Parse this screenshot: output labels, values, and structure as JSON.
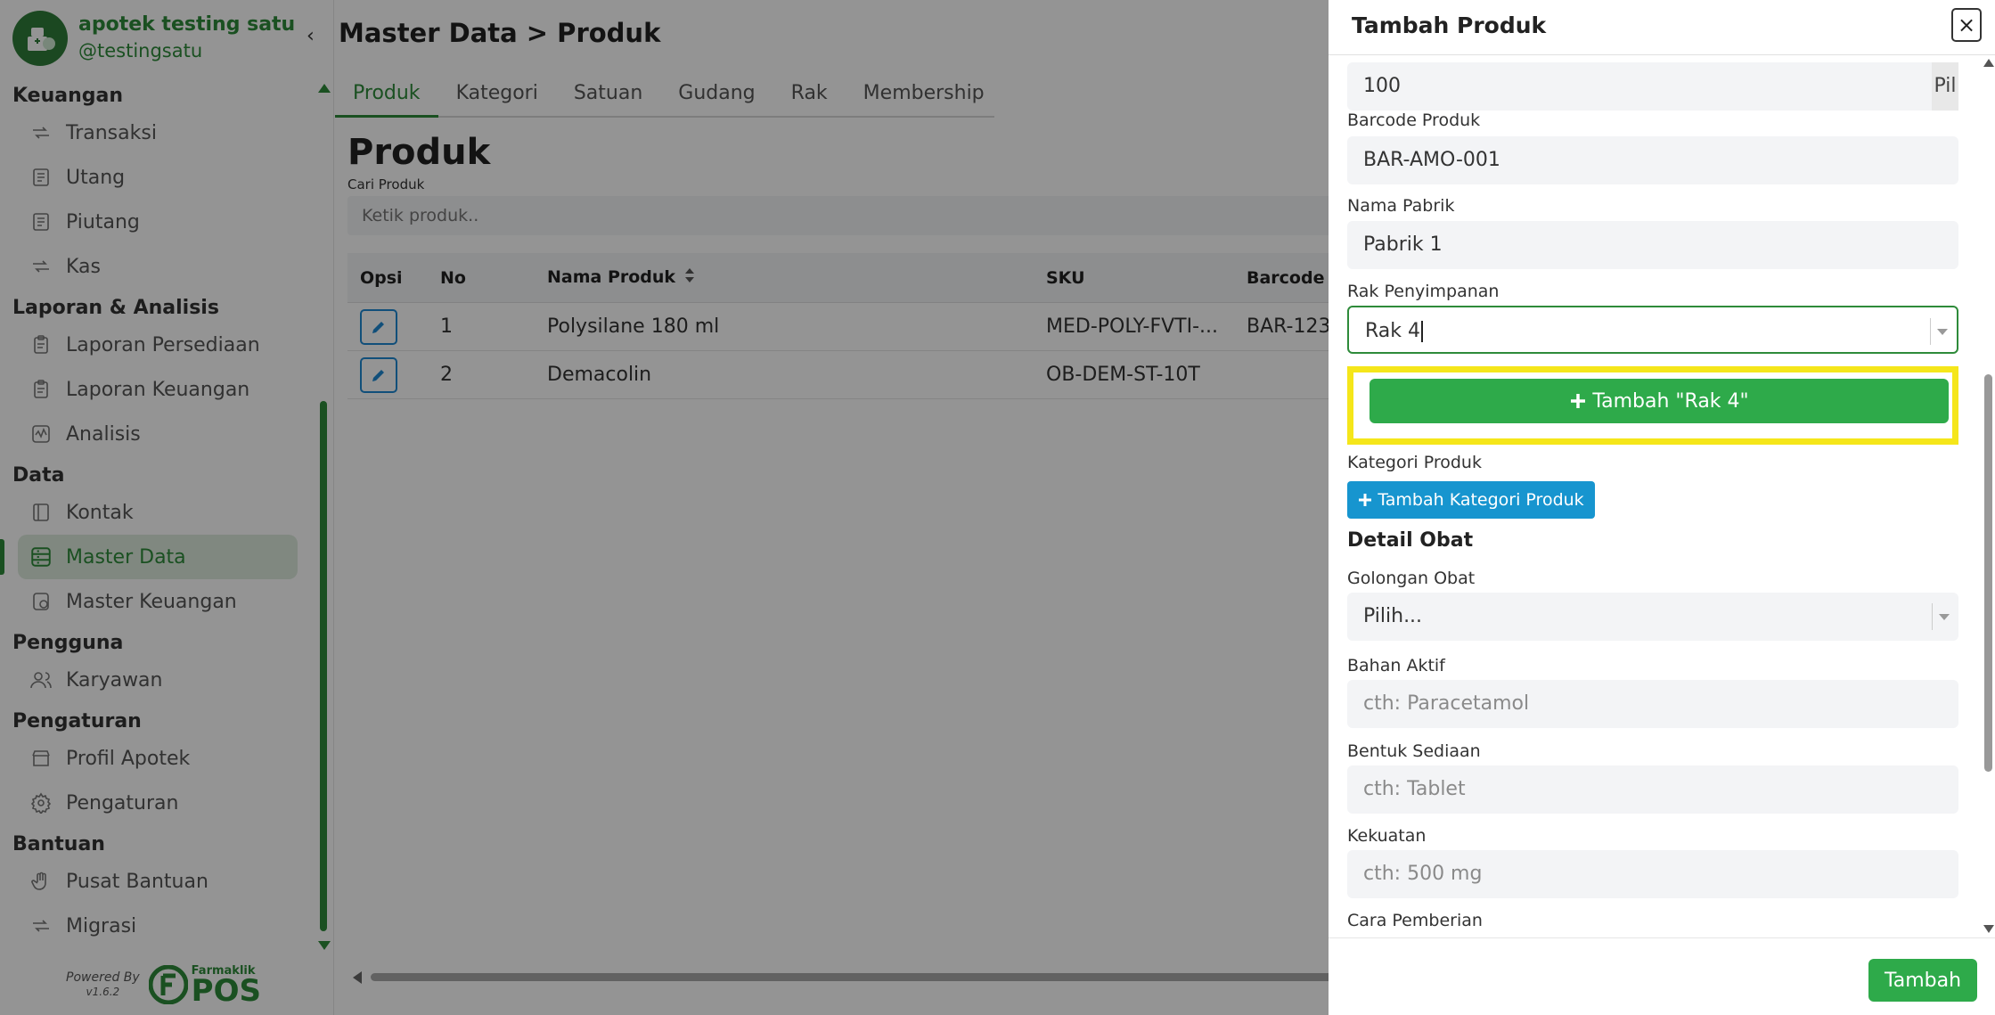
{
  "brand": {
    "name": "apotek testing satu",
    "handle": "@testingsatu"
  },
  "sidebar": {
    "sections": [
      {
        "title": "Keuangan",
        "items": [
          "Transaksi",
          "Utang",
          "Piutang",
          "Kas"
        ]
      },
      {
        "title": "Laporan & Analisis",
        "items": [
          "Laporan Persediaan",
          "Laporan Keuangan",
          "Analisis"
        ]
      },
      {
        "title": "Data",
        "items": [
          "Kontak",
          "Master Data",
          "Master Keuangan"
        ]
      },
      {
        "title": "Pengguna",
        "items": [
          "Karyawan"
        ]
      },
      {
        "title": "Pengaturan",
        "items": [
          "Profil Apotek",
          "Pengaturan"
        ]
      },
      {
        "title": "Bantuan",
        "items": [
          "Pusat Bantuan",
          "Migrasi"
        ]
      }
    ],
    "active_item": "Master Data",
    "powered_by": "Powered By",
    "version": "v1.6.2",
    "logo_small": "Farmaklik",
    "logo_big": "POS"
  },
  "main": {
    "page_title": "Master Data > Produk",
    "tabs": [
      "Produk",
      "Kategori",
      "Satuan",
      "Gudang",
      "Rak",
      "Membership"
    ],
    "section_title": "Produk",
    "search_label": "Cari Produk",
    "search_placeholder": "Ketik produk..",
    "table": {
      "headers": {
        "opsi": "Opsi",
        "no": "No",
        "nama": "Nama Produk",
        "sku": "SKU",
        "barcode": "Barcode"
      },
      "rows": [
        {
          "no": "1",
          "nama": "Polysilane 180 ml",
          "sku": "MED-POLY-FVTI-...",
          "barcode": "BAR-123"
        },
        {
          "no": "2",
          "nama": "Demacolin",
          "sku": "OB-DEM-ST-10T",
          "barcode": ""
        }
      ]
    }
  },
  "modal": {
    "title": "Tambah Produk",
    "close": "×",
    "qty_value": "100",
    "qty_unit": "Pil",
    "barcode_label": "Barcode Produk",
    "barcode_value": "BAR-AMO-001",
    "pabrik_label": "Nama Pabrik",
    "pabrik_value": "Pabrik 1",
    "rak_label": "Rak Penyimpanan",
    "rak_value": "Rak 4",
    "add_rak_button": "Tambah \"Rak 4\"",
    "kategori_label": "Kategori Produk",
    "add_kategori_button": "Tambah Kategori Produk",
    "detail_heading": "Detail Obat",
    "golongan_label": "Golongan Obat",
    "golongan_value": "Pilih...",
    "bahan_label": "Bahan Aktif",
    "bahan_placeholder": "cth: Paracetamol",
    "bentuk_label": "Bentuk Sediaan",
    "bentuk_placeholder": "cth: Tablet",
    "kekuatan_label": "Kekuatan",
    "kekuatan_placeholder": "cth: 500 mg",
    "cara_label": "Cara Pemberian",
    "submit_button": "Tambah"
  },
  "colors": {
    "brand_green": "#2e8b3a",
    "button_green": "#2eaa4a",
    "info_blue": "#1795cf",
    "highlight_yellow": "#f5e61a"
  }
}
